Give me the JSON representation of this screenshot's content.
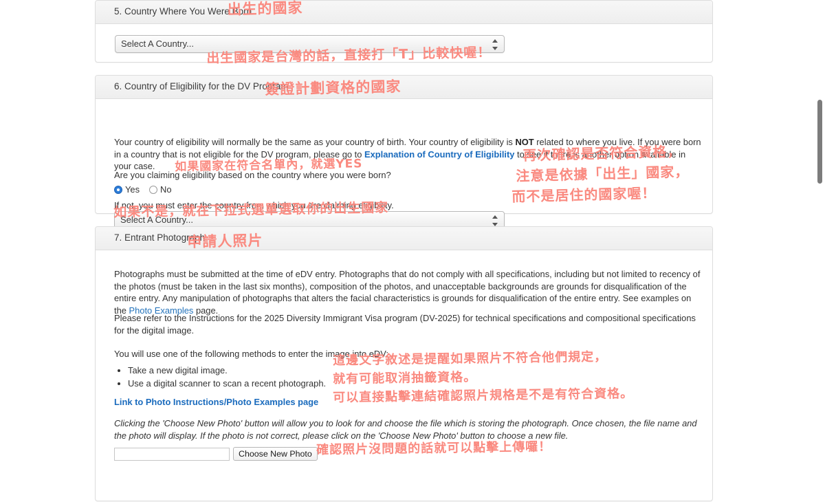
{
  "colors": {
    "annotation": "#fa8a80",
    "link": "#1a6bbd",
    "panel_border": "#dddddd",
    "radio_selected": "#2d7dd9"
  },
  "sections": {
    "country_born": {
      "title": "5. Country Where You Were Born",
      "select_value": "Select A Country...",
      "annotation_title": "出生的國家",
      "annotation_below": "出生國家是台灣的話，直接打「T」比較快喔！"
    },
    "eligibility": {
      "title": "6. Country of Eligibility for the DV Program",
      "annotation_title": "簽證計劃資格的國家",
      "paragraph_1a": "Your country of eligibility will normally be the same as your country of birth. Your country of eligibility is ",
      "paragraph_1b": "NOT",
      "paragraph_1c": " related to where you live. If you were born in a country that is not eligible for the DV program, please go to ",
      "link_text": "Explanation of Country of Eligibility",
      "paragraph_1d": " to see if there is another option available in your case.",
      "question": "Are you claiming eligibility based on the country where you were born?",
      "radio_yes": "Yes",
      "radio_no": "No",
      "radio_selected": "Yes",
      "annotation_radio": "如果國家在符合名單內，就選YES",
      "if_not_text": "If not, you must enter the country from which you are claiming eligibility.",
      "select_value": "Select A Country...",
      "annotation_below_select": "如果不是，就在下拉式選單選取你的出生國家",
      "annotation_right_1": "再次確認是否符合資格，",
      "annotation_right_2": "注意是依據「出生」國家，",
      "annotation_right_3": "而不是居住的國家喔！"
    },
    "photograph": {
      "title": "7. Entrant Photograph",
      "annotation_title": "申請人照片",
      "paragraph_1a": "Photographs must be submitted at the time of eDV entry. Photographs that do not comply with all specifications, including but not limited to recency of the photos (must be taken in the last six months), composition of the photos, and unacceptable backgrounds are grounds for disqualification of the entire entry. Any manipulation of photographs that alters the facial characteristics is grounds for disqualification of the entire entry. See examples on the ",
      "paragraph_1_link": "Photo Examples",
      "paragraph_1b": " page.",
      "paragraph_2": "Please refer to the Instructions for the 2025 Diversity Immigrant Visa program (DV-2025) for technical specifications and compositional specifications for the digital image.",
      "paragraph_3": "You will use one of the following methods to enter the image into eDV:",
      "methods": [
        "Take a new digital image.",
        "Use a digital scanner to scan a recent photograph."
      ],
      "photo_link": "Link to Photo Instructions/Photo Examples page",
      "italic_note": "Clicking the 'Choose New Photo' button will allow you to look for and choose the file which is storing the photograph. Once chosen, the file name and the photo will display. If the photo is not correct, please click on the 'Choose New Photo' button to choose a new file.",
      "file_input_value": "",
      "choose_button": "Choose New Photo",
      "annotation_methods_1": "這邊文字敘述是提醒如果照片不符合他們規定，",
      "annotation_methods_2": "就有可能取消抽籤資格。",
      "annotation_methods_3": "可以直接點擊連結確認照片規格是不是有符合資格。",
      "annotation_button": "確認照片沒問題的話就可以點擊上傳囉！"
    }
  }
}
